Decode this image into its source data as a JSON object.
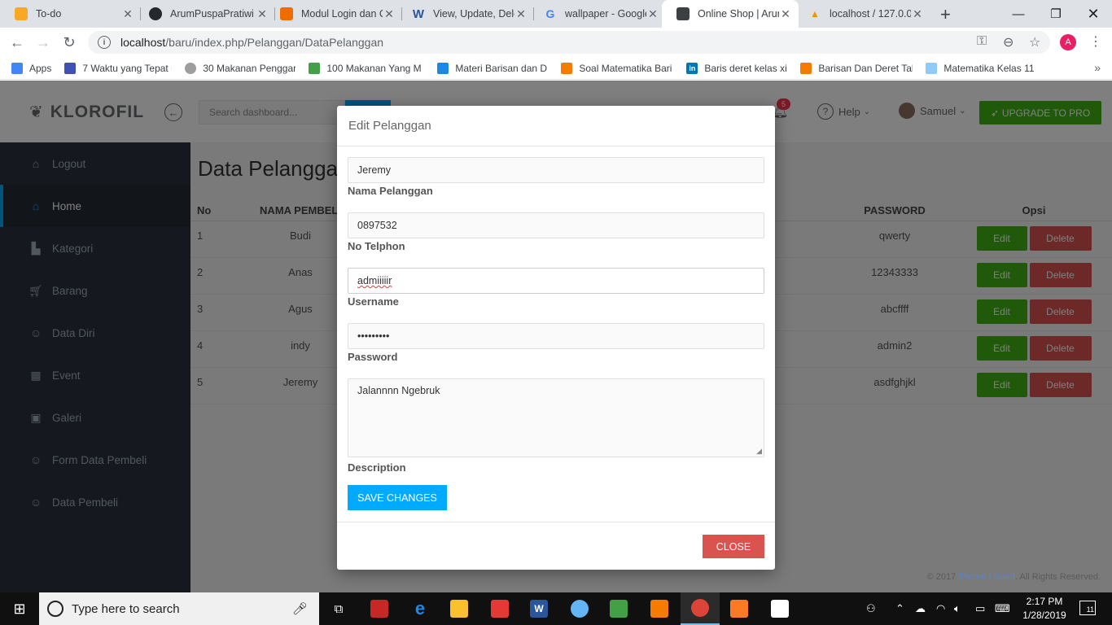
{
  "browser": {
    "tabs": [
      {
        "title": "To-do",
        "favicon_color": "#f9a825"
      },
      {
        "title": "ArumPuspaPratiwi",
        "favicon_color": "#24292e"
      },
      {
        "title": "Modul Login dan C",
        "favicon_color": "#ef6c00"
      },
      {
        "title": "View, Update, Dele",
        "favicon_color": "#2b579a"
      },
      {
        "title": "wallpaper - Google",
        "favicon_color": "#4285f4"
      },
      {
        "title": "Online Shop | Arum",
        "favicon_color": "#3c4043"
      },
      {
        "title": "localhost / 127.0.0",
        "favicon_color": "#f29111"
      }
    ],
    "active_tab_index": 5,
    "new_tab_label": "+",
    "url_host": "localhost",
    "url_path": "/baru/index.php/Pelanggan/DataPelanggan",
    "profile_initial": "A",
    "bookmarks": [
      {
        "label": "Apps",
        "icon_color": "#4285f4"
      },
      {
        "label": "7 Waktu yang Tepat u",
        "icon_color": "#3f51b5"
      },
      {
        "label": "30 Makanan Penggar",
        "icon_color": "#9e9e9e"
      },
      {
        "label": "100 Makanan Yang M",
        "icon_color": "#43a047"
      },
      {
        "label": "Materi Barisan dan D",
        "icon_color": "#1e88e5"
      },
      {
        "label": "Soal Matematika Bari",
        "icon_color": "#f57c00"
      },
      {
        "label": "Baris deret kelas xi",
        "icon_color": "#0077b5"
      },
      {
        "label": "Barisan Dan Deret Tal",
        "icon_color": "#f57c00"
      },
      {
        "label": "Matematika Kelas 11",
        "icon_color": "#90caf9"
      }
    ]
  },
  "app": {
    "logo": "KLOROFIL",
    "search_placeholder": "Search dashboard...",
    "notification_count": "5",
    "help_label": "Help",
    "user_name": "Samuel",
    "upgrade_label": "UPGRADE TO PRO",
    "accent": "#00aaff",
    "success": "#41b314",
    "danger": "#d9534f"
  },
  "sidebar": {
    "items": [
      {
        "label": "Logout",
        "icon": "home-icon"
      },
      {
        "label": "Home",
        "icon": "home-icon"
      },
      {
        "label": "Kategori",
        "icon": "bag-icon"
      },
      {
        "label": "Barang",
        "icon": "cart-icon"
      },
      {
        "label": "Data Diri",
        "icon": "user-icon"
      },
      {
        "label": "Event",
        "icon": "calendar-icon"
      },
      {
        "label": "Galeri",
        "icon": "image-icon"
      },
      {
        "label": "Form Data Pembeli",
        "icon": "user-icon"
      },
      {
        "label": "Data Pembeli",
        "icon": "user-icon"
      }
    ],
    "active_index": 1
  },
  "main": {
    "title": "Data Pelanggan",
    "columns": [
      "No",
      "NAMA PEMBELI",
      "",
      "",
      "PASSWORD",
      "Opsi"
    ],
    "rows": [
      {
        "no": "1",
        "nama": "Budi",
        "password": "qwerty"
      },
      {
        "no": "2",
        "nama": "Anas",
        "password": "12343333"
      },
      {
        "no": "3",
        "nama": "Agus",
        "password": "abcffff"
      },
      {
        "no": "4",
        "nama": "indy",
        "password": "admin2"
      },
      {
        "no": "5",
        "nama": "Jeremy",
        "password": "asdfghjkl"
      }
    ],
    "edit_label": "Edit",
    "delete_label": "Delete"
  },
  "modal": {
    "title": "Edit Pelanggan",
    "fields": [
      {
        "value": "Jeremy",
        "label": "Nama Pelanggan"
      },
      {
        "value": "0897532",
        "label": "No Telphon"
      },
      {
        "value": "admiiiiir",
        "label": "Username"
      },
      {
        "value": "•••••••••",
        "label": "Password"
      }
    ],
    "description_value": "Jalannnn Ngebruk",
    "description_label": "Description",
    "save_label": "SAVE CHANGES",
    "close_label": "CLOSE"
  },
  "footer": {
    "prefix": "© 2017 ",
    "link": "Theme I Need",
    "suffix": ". All Rights Reserved."
  },
  "taskbar": {
    "search_placeholder": "Type here to search",
    "time": "2:17 PM",
    "date": "1/28/2019",
    "notification_count": "11"
  }
}
